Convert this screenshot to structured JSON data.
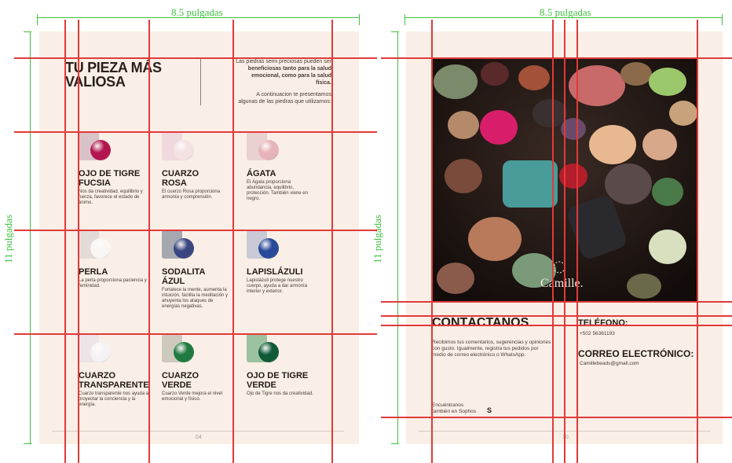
{
  "dimensions": {
    "width_label": "8.5 pulgadas",
    "height_label": "11 pulgadas"
  },
  "left_page": {
    "title_line1": "TU PIEZA MÁS",
    "title_line2": "VALIOSA",
    "intro_lines": [
      "Las piedras semi preciosas pueden ser",
      "beneficiosas tanto para la salud",
      "emocional, como para la salud",
      "física.",
      "",
      "A continuacion te presentamos",
      "algunas de las piedras que utilizamos:"
    ],
    "gems": [
      {
        "name_line1": "OJO DE TIGRE",
        "name_line2": "FUCSIA",
        "desc": "Nos da creatividad, equilibrio y fuerza, favorece el estado de ánimo.",
        "tile_color": "#d9c3c8",
        "stone_color": "#b2154f"
      },
      {
        "name_line1": "CUARZO",
        "name_line2": "ROSA",
        "desc": "El cuarzo Rosa proporciona armonía y comprensión.",
        "tile_color": "#f0d9dc",
        "stone_color": "#f4e1e3"
      },
      {
        "name_line1": "ÁGATA",
        "name_line2": "",
        "desc": "El Ágata proporciona abundancia, equilibrio, protección. También viene en negro.",
        "tile_color": "#ead0d0",
        "stone_color": "#e6b3b8"
      },
      {
        "name_line1": "PERLA",
        "name_line2": "",
        "desc": "La perla proporciona paciencia y feminidad.",
        "tile_color": "#e2dbd7",
        "stone_color": "#faf6f3"
      },
      {
        "name_line1": "SODALITA",
        "name_line2": "ÁZUL",
        "desc": "Fortalece la mente, aumenta la intuición, facilita la meditación y ahuyenta los ataques de energías negativas.",
        "tile_color": "#a6a8b0",
        "stone_color": "#3a4680"
      },
      {
        "name_line1": "LAPISLÁZULI",
        "name_line2": "",
        "desc": "Lapislázuli protege nuestro cuerpo, ayuda a dar armonía interior y exterior.",
        "tile_color": "#c9cad6",
        "stone_color": "#294a9a"
      },
      {
        "name_line1": "CUARZO",
        "name_line2": "TRANSPARENTE",
        "desc": "Cuarzo transparente nos ayuda a proyectar la conciencia y la energía.",
        "tile_color": "#ece4e6",
        "stone_color": "#f5f2f5"
      },
      {
        "name_line1": "CUARZO",
        "name_line2": "VERDE",
        "desc": "Cuarzo Verde mejora el nivel emocional y físico.",
        "tile_color": "#cec9bd",
        "stone_color": "#1f7a3f"
      },
      {
        "name_line1": "OJO DE TIGRE",
        "name_line2": "VERDE",
        "desc": "Ojo de Tigre nos da creatividad.",
        "tile_color": "#9cc29f",
        "stone_color": "#0f5a37"
      }
    ],
    "page_number": "04"
  },
  "right_page": {
    "brand": "Camille.",
    "contact_title": "CONTÁCTANOS",
    "contact_body": "Recibimos tus comentarios, sugerencias y opiniones con gusto. Igualmente, registra tus pedidos por medio de correo electrónico o WhatsApp.",
    "find_line1": "Encuéntranos",
    "find_line2": "también en Sophos",
    "sophos_mark": "S",
    "phone_title": "TELÉFONO:",
    "phone_value": "+502 56361193",
    "email_title": "CORREO ELECTRÓNICO:",
    "email_value": "Camillebeads@gmail.com",
    "page_number": "10"
  },
  "colors": {
    "page_bg": "#f9efe6",
    "guide_red": "#e23a3a",
    "guide_green": "#3fbf3f"
  }
}
